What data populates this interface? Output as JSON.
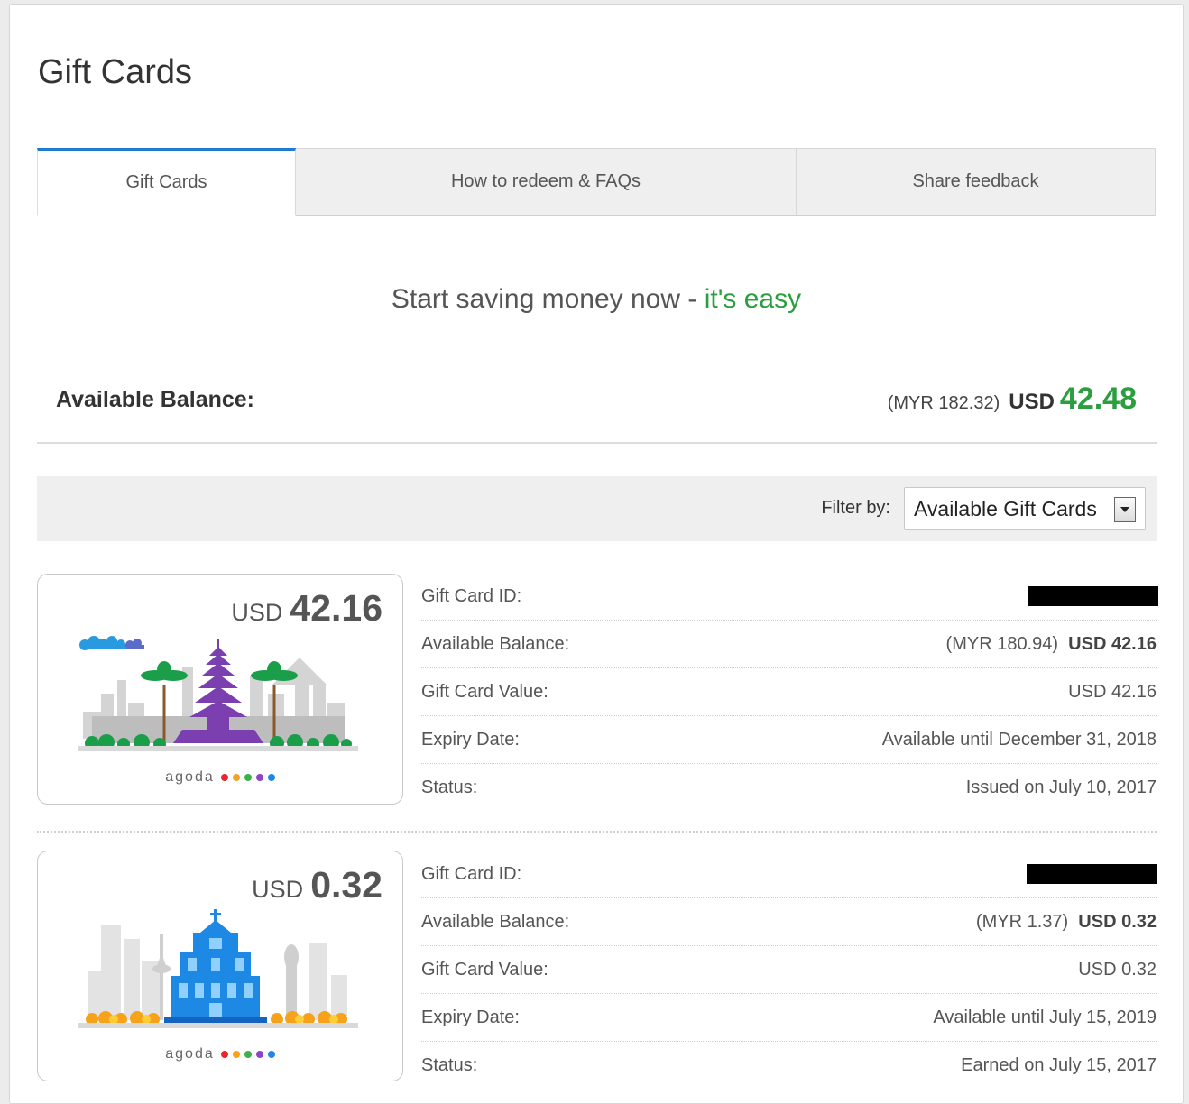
{
  "page": {
    "title": "Gift Cards"
  },
  "tabs": [
    {
      "label": "Gift Cards",
      "active": true
    },
    {
      "label": "How to redeem & FAQs",
      "active": false
    },
    {
      "label": "Share feedback",
      "active": false
    }
  ],
  "headline": {
    "text": "Start saving money now - ",
    "accent": "it's easy"
  },
  "balance": {
    "label": "Available Balance:",
    "myr": "(MYR 182.32)",
    "currency": "USD",
    "amount": "42.48"
  },
  "filter": {
    "label": "Filter by:",
    "selected": "Available Gift Cards"
  },
  "cards": [
    {
      "currency": "USD",
      "amount": "42.16",
      "brand": "agoda",
      "details": {
        "id_label": "Gift Card ID:",
        "balance_label": "Available Balance:",
        "balance_myr": "(MYR 180.94)",
        "balance_usd": "USD 42.16",
        "value_label": "Gift Card Value:",
        "value": "USD 42.16",
        "expiry_label": "Expiry Date:",
        "expiry": "Available until December 31, 2018",
        "status_label": "Status:",
        "status": "Issued on July 10, 2017"
      }
    },
    {
      "currency": "USD",
      "amount": "0.32",
      "brand": "agoda",
      "details": {
        "id_label": "Gift Card ID:",
        "balance_label": "Available Balance:",
        "balance_myr": "(MYR 1.37)",
        "balance_usd": "USD 0.32",
        "value_label": "Gift Card Value:",
        "value": "USD 0.32",
        "expiry_label": "Expiry Date:",
        "expiry": "Available until July 15, 2019",
        "status_label": "Status:",
        "status": "Earned on July 15, 2017"
      }
    }
  ],
  "brand_dots": [
    "#e8262b",
    "#f7a21b",
    "#3cb04b",
    "#8e44c9",
    "#1e88e5"
  ]
}
